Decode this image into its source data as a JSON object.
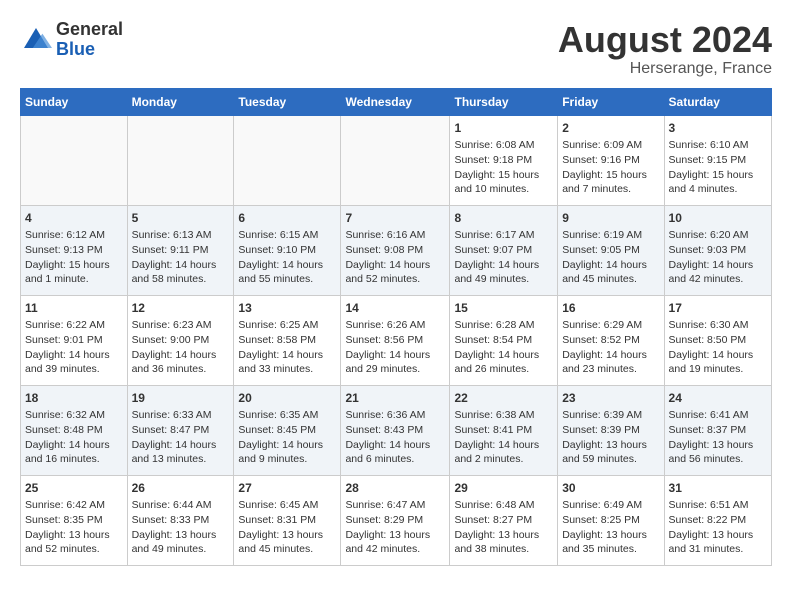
{
  "logo": {
    "general": "General",
    "blue": "Blue"
  },
  "header": {
    "month_year": "August 2024",
    "location": "Herserange, France"
  },
  "days_of_week": [
    "Sunday",
    "Monday",
    "Tuesday",
    "Wednesday",
    "Thursday",
    "Friday",
    "Saturday"
  ],
  "weeks": [
    [
      {
        "day": "",
        "info": ""
      },
      {
        "day": "",
        "info": ""
      },
      {
        "day": "",
        "info": ""
      },
      {
        "day": "",
        "info": ""
      },
      {
        "day": "1",
        "info": "Sunrise: 6:08 AM\nSunset: 9:18 PM\nDaylight: 15 hours\nand 10 minutes."
      },
      {
        "day": "2",
        "info": "Sunrise: 6:09 AM\nSunset: 9:16 PM\nDaylight: 15 hours\nand 7 minutes."
      },
      {
        "day": "3",
        "info": "Sunrise: 6:10 AM\nSunset: 9:15 PM\nDaylight: 15 hours\nand 4 minutes."
      }
    ],
    [
      {
        "day": "4",
        "info": "Sunrise: 6:12 AM\nSunset: 9:13 PM\nDaylight: 15 hours\nand 1 minute."
      },
      {
        "day": "5",
        "info": "Sunrise: 6:13 AM\nSunset: 9:11 PM\nDaylight: 14 hours\nand 58 minutes."
      },
      {
        "day": "6",
        "info": "Sunrise: 6:15 AM\nSunset: 9:10 PM\nDaylight: 14 hours\nand 55 minutes."
      },
      {
        "day": "7",
        "info": "Sunrise: 6:16 AM\nSunset: 9:08 PM\nDaylight: 14 hours\nand 52 minutes."
      },
      {
        "day": "8",
        "info": "Sunrise: 6:17 AM\nSunset: 9:07 PM\nDaylight: 14 hours\nand 49 minutes."
      },
      {
        "day": "9",
        "info": "Sunrise: 6:19 AM\nSunset: 9:05 PM\nDaylight: 14 hours\nand 45 minutes."
      },
      {
        "day": "10",
        "info": "Sunrise: 6:20 AM\nSunset: 9:03 PM\nDaylight: 14 hours\nand 42 minutes."
      }
    ],
    [
      {
        "day": "11",
        "info": "Sunrise: 6:22 AM\nSunset: 9:01 PM\nDaylight: 14 hours\nand 39 minutes."
      },
      {
        "day": "12",
        "info": "Sunrise: 6:23 AM\nSunset: 9:00 PM\nDaylight: 14 hours\nand 36 minutes."
      },
      {
        "day": "13",
        "info": "Sunrise: 6:25 AM\nSunset: 8:58 PM\nDaylight: 14 hours\nand 33 minutes."
      },
      {
        "day": "14",
        "info": "Sunrise: 6:26 AM\nSunset: 8:56 PM\nDaylight: 14 hours\nand 29 minutes."
      },
      {
        "day": "15",
        "info": "Sunrise: 6:28 AM\nSunset: 8:54 PM\nDaylight: 14 hours\nand 26 minutes."
      },
      {
        "day": "16",
        "info": "Sunrise: 6:29 AM\nSunset: 8:52 PM\nDaylight: 14 hours\nand 23 minutes."
      },
      {
        "day": "17",
        "info": "Sunrise: 6:30 AM\nSunset: 8:50 PM\nDaylight: 14 hours\nand 19 minutes."
      }
    ],
    [
      {
        "day": "18",
        "info": "Sunrise: 6:32 AM\nSunset: 8:48 PM\nDaylight: 14 hours\nand 16 minutes."
      },
      {
        "day": "19",
        "info": "Sunrise: 6:33 AM\nSunset: 8:47 PM\nDaylight: 14 hours\nand 13 minutes."
      },
      {
        "day": "20",
        "info": "Sunrise: 6:35 AM\nSunset: 8:45 PM\nDaylight: 14 hours\nand 9 minutes."
      },
      {
        "day": "21",
        "info": "Sunrise: 6:36 AM\nSunset: 8:43 PM\nDaylight: 14 hours\nand 6 minutes."
      },
      {
        "day": "22",
        "info": "Sunrise: 6:38 AM\nSunset: 8:41 PM\nDaylight: 14 hours\nand 2 minutes."
      },
      {
        "day": "23",
        "info": "Sunrise: 6:39 AM\nSunset: 8:39 PM\nDaylight: 13 hours\nand 59 minutes."
      },
      {
        "day": "24",
        "info": "Sunrise: 6:41 AM\nSunset: 8:37 PM\nDaylight: 13 hours\nand 56 minutes."
      }
    ],
    [
      {
        "day": "25",
        "info": "Sunrise: 6:42 AM\nSunset: 8:35 PM\nDaylight: 13 hours\nand 52 minutes."
      },
      {
        "day": "26",
        "info": "Sunrise: 6:44 AM\nSunset: 8:33 PM\nDaylight: 13 hours\nand 49 minutes."
      },
      {
        "day": "27",
        "info": "Sunrise: 6:45 AM\nSunset: 8:31 PM\nDaylight: 13 hours\nand 45 minutes."
      },
      {
        "day": "28",
        "info": "Sunrise: 6:47 AM\nSunset: 8:29 PM\nDaylight: 13 hours\nand 42 minutes."
      },
      {
        "day": "29",
        "info": "Sunrise: 6:48 AM\nSunset: 8:27 PM\nDaylight: 13 hours\nand 38 minutes."
      },
      {
        "day": "30",
        "info": "Sunrise: 6:49 AM\nSunset: 8:25 PM\nDaylight: 13 hours\nand 35 minutes."
      },
      {
        "day": "31",
        "info": "Sunrise: 6:51 AM\nSunset: 8:22 PM\nDaylight: 13 hours\nand 31 minutes."
      }
    ]
  ]
}
